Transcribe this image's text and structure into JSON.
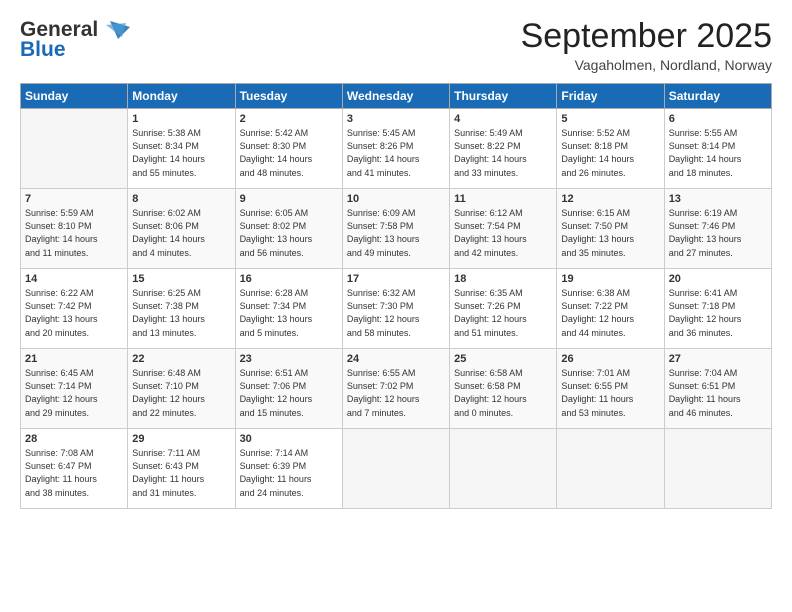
{
  "header": {
    "logo_general": "General",
    "logo_blue": "Blue",
    "title": "September 2025",
    "subtitle": "Vagaholmen, Nordland, Norway"
  },
  "columns": [
    "Sunday",
    "Monday",
    "Tuesday",
    "Wednesday",
    "Thursday",
    "Friday",
    "Saturday"
  ],
  "weeks": [
    [
      {
        "day": "",
        "lines": []
      },
      {
        "day": "1",
        "lines": [
          "Sunrise: 5:38 AM",
          "Sunset: 8:34 PM",
          "Daylight: 14 hours",
          "and 55 minutes."
        ]
      },
      {
        "day": "2",
        "lines": [
          "Sunrise: 5:42 AM",
          "Sunset: 8:30 PM",
          "Daylight: 14 hours",
          "and 48 minutes."
        ]
      },
      {
        "day": "3",
        "lines": [
          "Sunrise: 5:45 AM",
          "Sunset: 8:26 PM",
          "Daylight: 14 hours",
          "and 41 minutes."
        ]
      },
      {
        "day": "4",
        "lines": [
          "Sunrise: 5:49 AM",
          "Sunset: 8:22 PM",
          "Daylight: 14 hours",
          "and 33 minutes."
        ]
      },
      {
        "day": "5",
        "lines": [
          "Sunrise: 5:52 AM",
          "Sunset: 8:18 PM",
          "Daylight: 14 hours",
          "and 26 minutes."
        ]
      },
      {
        "day": "6",
        "lines": [
          "Sunrise: 5:55 AM",
          "Sunset: 8:14 PM",
          "Daylight: 14 hours",
          "and 18 minutes."
        ]
      }
    ],
    [
      {
        "day": "7",
        "lines": [
          "Sunrise: 5:59 AM",
          "Sunset: 8:10 PM",
          "Daylight: 14 hours",
          "and 11 minutes."
        ]
      },
      {
        "day": "8",
        "lines": [
          "Sunrise: 6:02 AM",
          "Sunset: 8:06 PM",
          "Daylight: 14 hours",
          "and 4 minutes."
        ]
      },
      {
        "day": "9",
        "lines": [
          "Sunrise: 6:05 AM",
          "Sunset: 8:02 PM",
          "Daylight: 13 hours",
          "and 56 minutes."
        ]
      },
      {
        "day": "10",
        "lines": [
          "Sunrise: 6:09 AM",
          "Sunset: 7:58 PM",
          "Daylight: 13 hours",
          "and 49 minutes."
        ]
      },
      {
        "day": "11",
        "lines": [
          "Sunrise: 6:12 AM",
          "Sunset: 7:54 PM",
          "Daylight: 13 hours",
          "and 42 minutes."
        ]
      },
      {
        "day": "12",
        "lines": [
          "Sunrise: 6:15 AM",
          "Sunset: 7:50 PM",
          "Daylight: 13 hours",
          "and 35 minutes."
        ]
      },
      {
        "day": "13",
        "lines": [
          "Sunrise: 6:19 AM",
          "Sunset: 7:46 PM",
          "Daylight: 13 hours",
          "and 27 minutes."
        ]
      }
    ],
    [
      {
        "day": "14",
        "lines": [
          "Sunrise: 6:22 AM",
          "Sunset: 7:42 PM",
          "Daylight: 13 hours",
          "and 20 minutes."
        ]
      },
      {
        "day": "15",
        "lines": [
          "Sunrise: 6:25 AM",
          "Sunset: 7:38 PM",
          "Daylight: 13 hours",
          "and 13 minutes."
        ]
      },
      {
        "day": "16",
        "lines": [
          "Sunrise: 6:28 AM",
          "Sunset: 7:34 PM",
          "Daylight: 13 hours",
          "and 5 minutes."
        ]
      },
      {
        "day": "17",
        "lines": [
          "Sunrise: 6:32 AM",
          "Sunset: 7:30 PM",
          "Daylight: 12 hours",
          "and 58 minutes."
        ]
      },
      {
        "day": "18",
        "lines": [
          "Sunrise: 6:35 AM",
          "Sunset: 7:26 PM",
          "Daylight: 12 hours",
          "and 51 minutes."
        ]
      },
      {
        "day": "19",
        "lines": [
          "Sunrise: 6:38 AM",
          "Sunset: 7:22 PM",
          "Daylight: 12 hours",
          "and 44 minutes."
        ]
      },
      {
        "day": "20",
        "lines": [
          "Sunrise: 6:41 AM",
          "Sunset: 7:18 PM",
          "Daylight: 12 hours",
          "and 36 minutes."
        ]
      }
    ],
    [
      {
        "day": "21",
        "lines": [
          "Sunrise: 6:45 AM",
          "Sunset: 7:14 PM",
          "Daylight: 12 hours",
          "and 29 minutes."
        ]
      },
      {
        "day": "22",
        "lines": [
          "Sunrise: 6:48 AM",
          "Sunset: 7:10 PM",
          "Daylight: 12 hours",
          "and 22 minutes."
        ]
      },
      {
        "day": "23",
        "lines": [
          "Sunrise: 6:51 AM",
          "Sunset: 7:06 PM",
          "Daylight: 12 hours",
          "and 15 minutes."
        ]
      },
      {
        "day": "24",
        "lines": [
          "Sunrise: 6:55 AM",
          "Sunset: 7:02 PM",
          "Daylight: 12 hours",
          "and 7 minutes."
        ]
      },
      {
        "day": "25",
        "lines": [
          "Sunrise: 6:58 AM",
          "Sunset: 6:58 PM",
          "Daylight: 12 hours",
          "and 0 minutes."
        ]
      },
      {
        "day": "26",
        "lines": [
          "Sunrise: 7:01 AM",
          "Sunset: 6:55 PM",
          "Daylight: 11 hours",
          "and 53 minutes."
        ]
      },
      {
        "day": "27",
        "lines": [
          "Sunrise: 7:04 AM",
          "Sunset: 6:51 PM",
          "Daylight: 11 hours",
          "and 46 minutes."
        ]
      }
    ],
    [
      {
        "day": "28",
        "lines": [
          "Sunrise: 7:08 AM",
          "Sunset: 6:47 PM",
          "Daylight: 11 hours",
          "and 38 minutes."
        ]
      },
      {
        "day": "29",
        "lines": [
          "Sunrise: 7:11 AM",
          "Sunset: 6:43 PM",
          "Daylight: 11 hours",
          "and 31 minutes."
        ]
      },
      {
        "day": "30",
        "lines": [
          "Sunrise: 7:14 AM",
          "Sunset: 6:39 PM",
          "Daylight: 11 hours",
          "and 24 minutes."
        ]
      },
      {
        "day": "",
        "lines": []
      },
      {
        "day": "",
        "lines": []
      },
      {
        "day": "",
        "lines": []
      },
      {
        "day": "",
        "lines": []
      }
    ]
  ]
}
